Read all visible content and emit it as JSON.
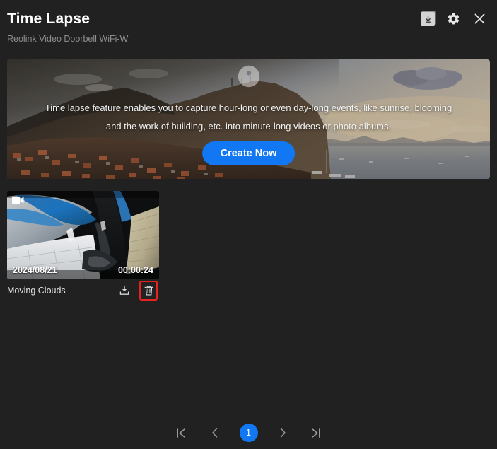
{
  "window": {
    "background_color": "#212121",
    "accent_color": "#1277f2",
    "highlight_color": "#e8231f"
  },
  "header": {
    "title": "Time Lapse",
    "device_name": "Reolink Video Doorbell WiFi-W",
    "icons": [
      {
        "name": "download-icon",
        "label": "Download"
      },
      {
        "name": "gear-icon",
        "label": "Settings"
      },
      {
        "name": "close-icon",
        "label": "Close"
      }
    ]
  },
  "banner": {
    "logo": "reolink-logo",
    "description": "Time lapse feature enables you to capture hour-long or even day-long events, like sunrise, blooming and the work of building, etc. into minute-long videos or photo albums.",
    "create_button": "Create Now"
  },
  "items": [
    {
      "name": "Moving Clouds",
      "date": "2024/08/21",
      "duration": "00:00:24",
      "media_type_icon": "video-camera-icon",
      "actions": [
        {
          "name": "download-item-icon",
          "label": "Download",
          "highlighted": false
        },
        {
          "name": "delete-item-icon",
          "label": "Delete",
          "highlighted": true
        }
      ]
    }
  ],
  "pagination": {
    "first_label": "⏮",
    "prev_label": "‹",
    "current_page": "1",
    "next_label": "›",
    "last_label": "⏭"
  }
}
